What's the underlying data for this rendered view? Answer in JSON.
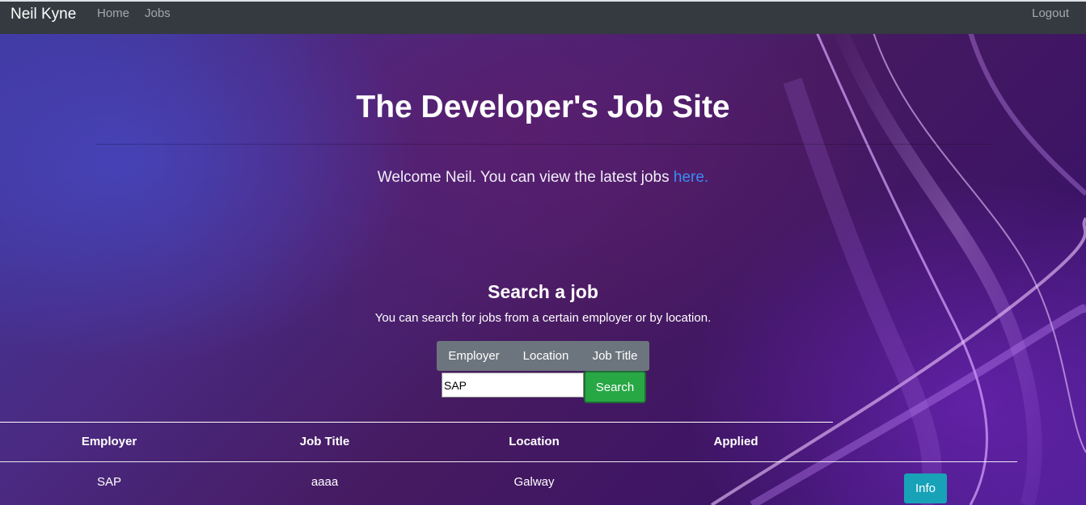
{
  "navbar": {
    "brand": "Neil Kyne",
    "links": {
      "home": "Home",
      "jobs": "Jobs"
    },
    "logout": "Logout"
  },
  "hero": {
    "title": "The Developer's Job Site",
    "welcome_text": "Welcome Neil. You can view the latest jobs ",
    "welcome_link": "here."
  },
  "search": {
    "title": "Search a job",
    "subtitle": "You can search for jobs from a certain employer or by location.",
    "filters": {
      "employer": "Employer",
      "location": "Location",
      "job_title": "Job Title"
    },
    "input_value": "SAP",
    "button_label": "Search"
  },
  "table": {
    "headers": [
      "Employer",
      "Job Title",
      "Location",
      "Applied"
    ],
    "rows": [
      {
        "employer": "SAP",
        "job_title": "aaaa",
        "location": "Galway",
        "applied": "",
        "action_label": "Info"
      }
    ]
  },
  "colors": {
    "navbar": "#343a40",
    "link": "#3b8cf5",
    "secondary_button": "#6c757d",
    "success_button": "#28a745",
    "info_button": "#17a2b8"
  },
  "icons": []
}
